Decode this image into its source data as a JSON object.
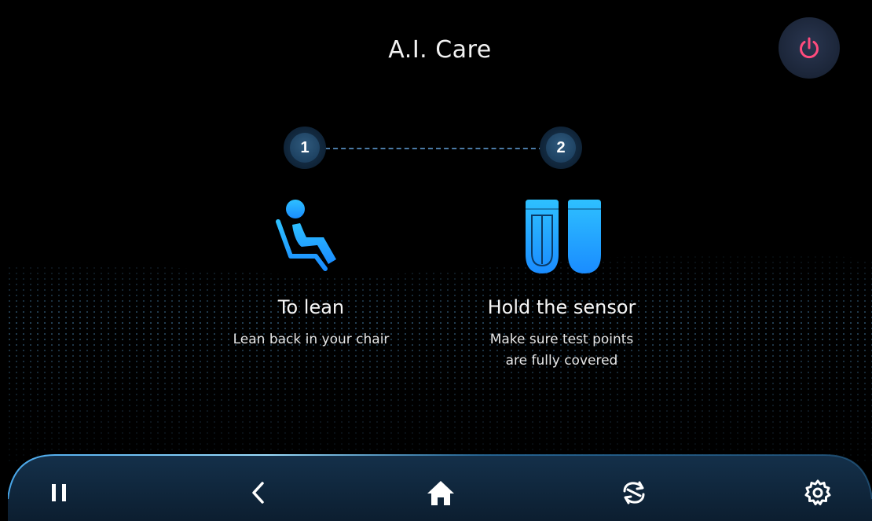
{
  "header": {
    "title": "A.I. Care",
    "power_icon": "power-icon",
    "power_color": "#ff4b7d"
  },
  "steps": [
    {
      "number": "1",
      "icon": "seat-lean-icon",
      "title": "To lean",
      "description": [
        "Lean back in your chair"
      ]
    },
    {
      "number": "2",
      "icon": "sensor-grips-icon",
      "title": "Hold the sensor",
      "description": [
        "Make sure test points",
        "are fully covered"
      ]
    }
  ],
  "navbar": {
    "items": [
      {
        "name": "pause",
        "icon": "pause-icon"
      },
      {
        "name": "back",
        "icon": "chevron-left-icon"
      },
      {
        "name": "home",
        "icon": "home-icon"
      },
      {
        "name": "switch",
        "icon": "sync-icon"
      },
      {
        "name": "settings",
        "icon": "gear-icon"
      }
    ]
  },
  "colors": {
    "accent": "#1a9bff",
    "accent_light": "#2ec0ff",
    "background": "#000000",
    "navbar": "#0f2337"
  }
}
